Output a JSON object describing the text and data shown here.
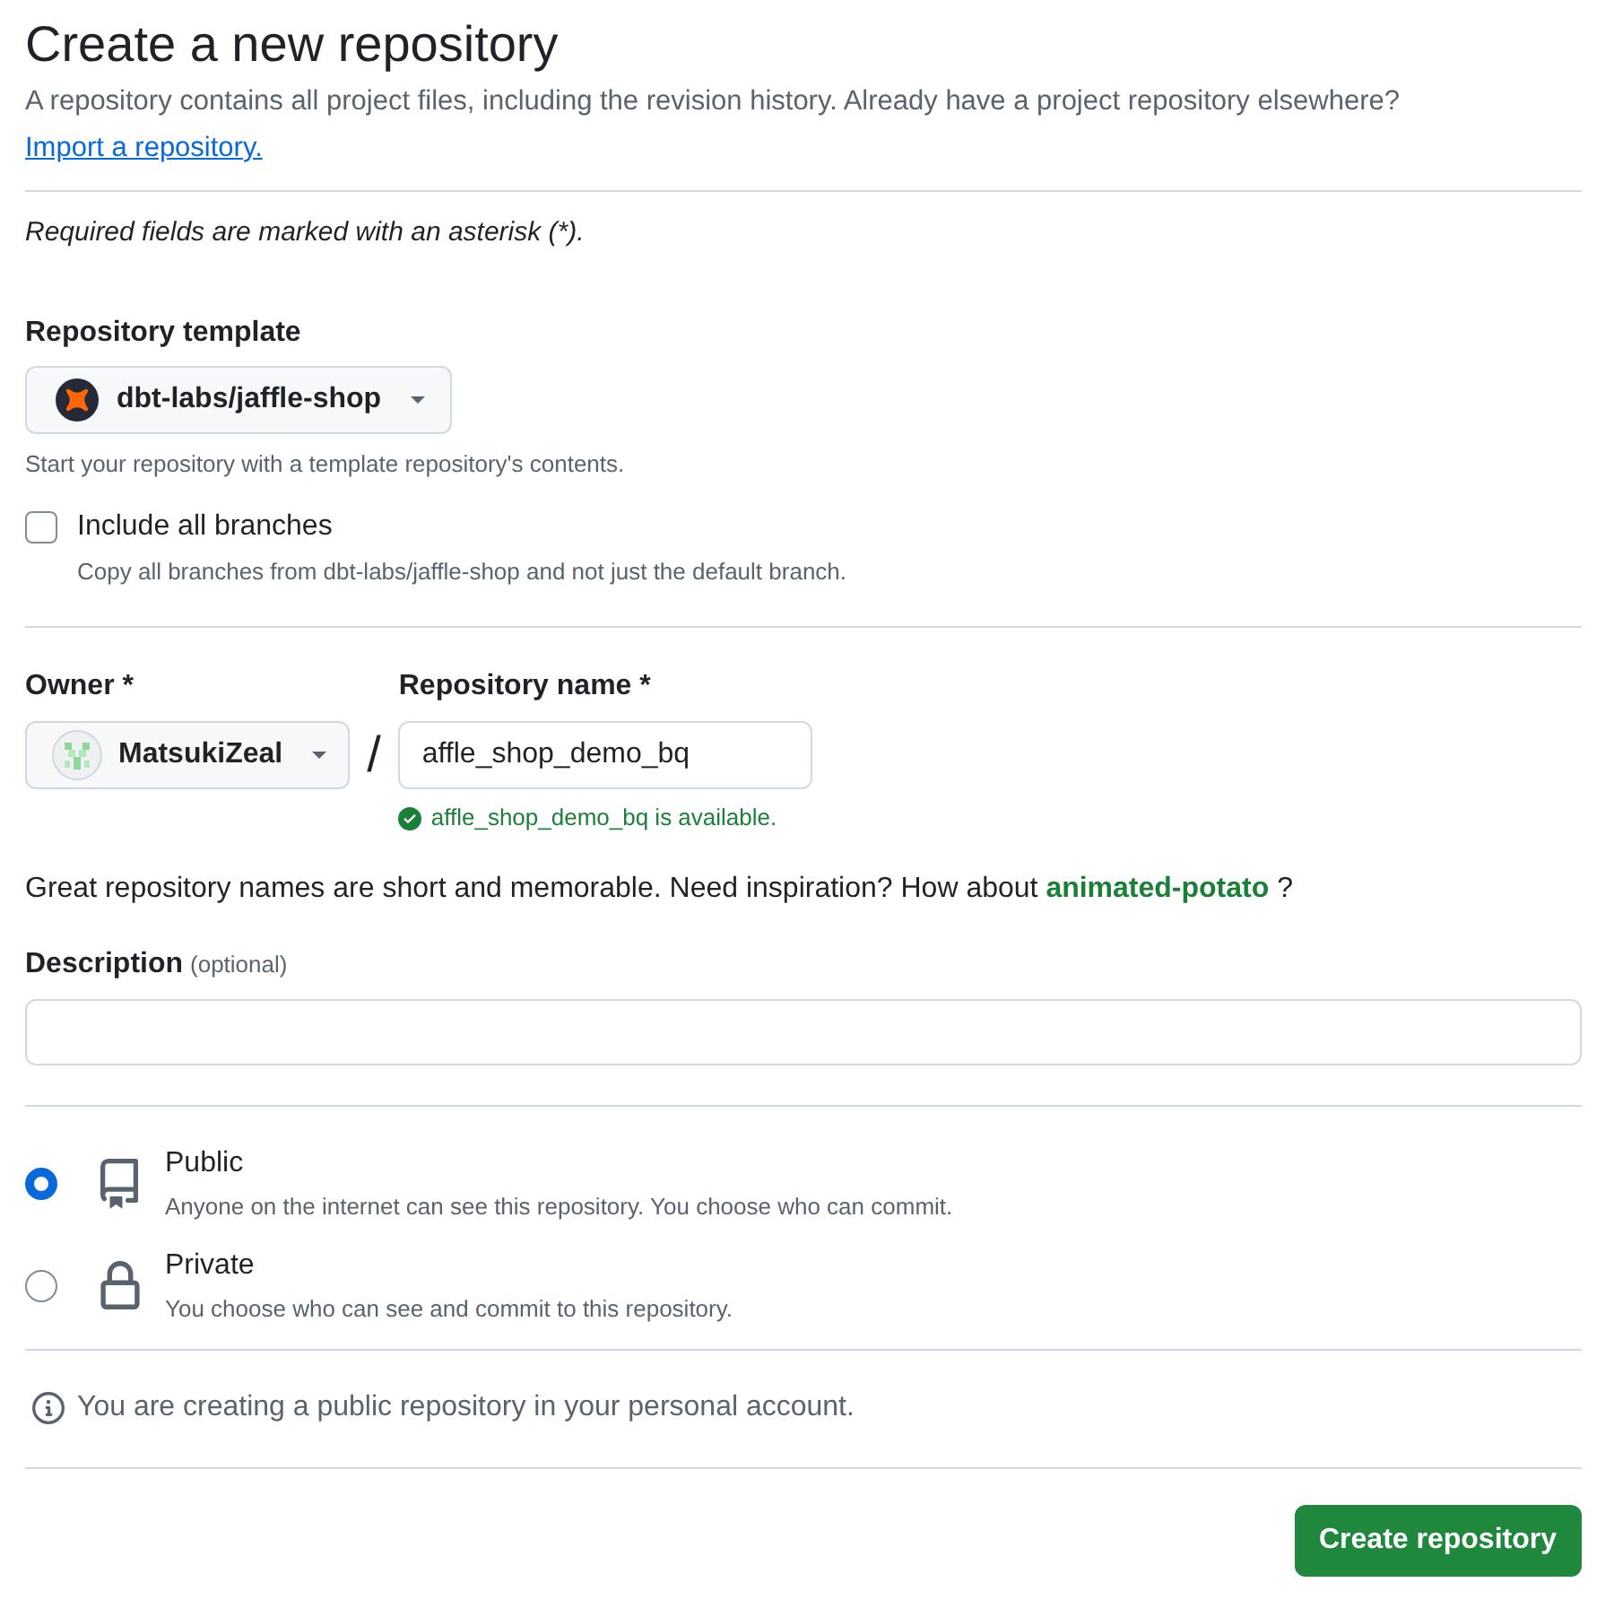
{
  "header": {
    "title": "Create a new repository",
    "subtitle": "A repository contains all project files, including the revision history. Already have a project repository elsewhere?",
    "import_link": "Import a repository."
  },
  "required_note": "Required fields are marked with an asterisk (*).",
  "template": {
    "label": "Repository template",
    "value": "dbt-labs/jaffle-shop",
    "hint": "Start your repository with a template repository's contents.",
    "include_all_branches": {
      "label": "Include all branches",
      "description": "Copy all branches from dbt-labs/jaffle-shop and not just the default branch.",
      "checked": false
    }
  },
  "owner": {
    "label": "Owner *",
    "value": "MatsukiZeal"
  },
  "separator": "/",
  "repository_name": {
    "label": "Repository name *",
    "value": "affle_shop_demo_bq",
    "validation": "affle_shop_demo_bq is available."
  },
  "suggestion": {
    "text": "Great repository names are short and memorable. Need inspiration? How about",
    "name": "animated-potato",
    "suffix": "?"
  },
  "description": {
    "label": "Description",
    "hint": "(optional)"
  },
  "visibility": [
    {
      "kind": "public",
      "label": "Public",
      "description": "Anyone on the internet can see this repository. You choose who can commit.",
      "selected": true
    },
    {
      "kind": "private",
      "label": "Private",
      "description": "You choose who can see and commit to this repository.",
      "selected": false
    }
  ],
  "info": "You are creating a public repository in your personal account.",
  "submit": "Create repository"
}
